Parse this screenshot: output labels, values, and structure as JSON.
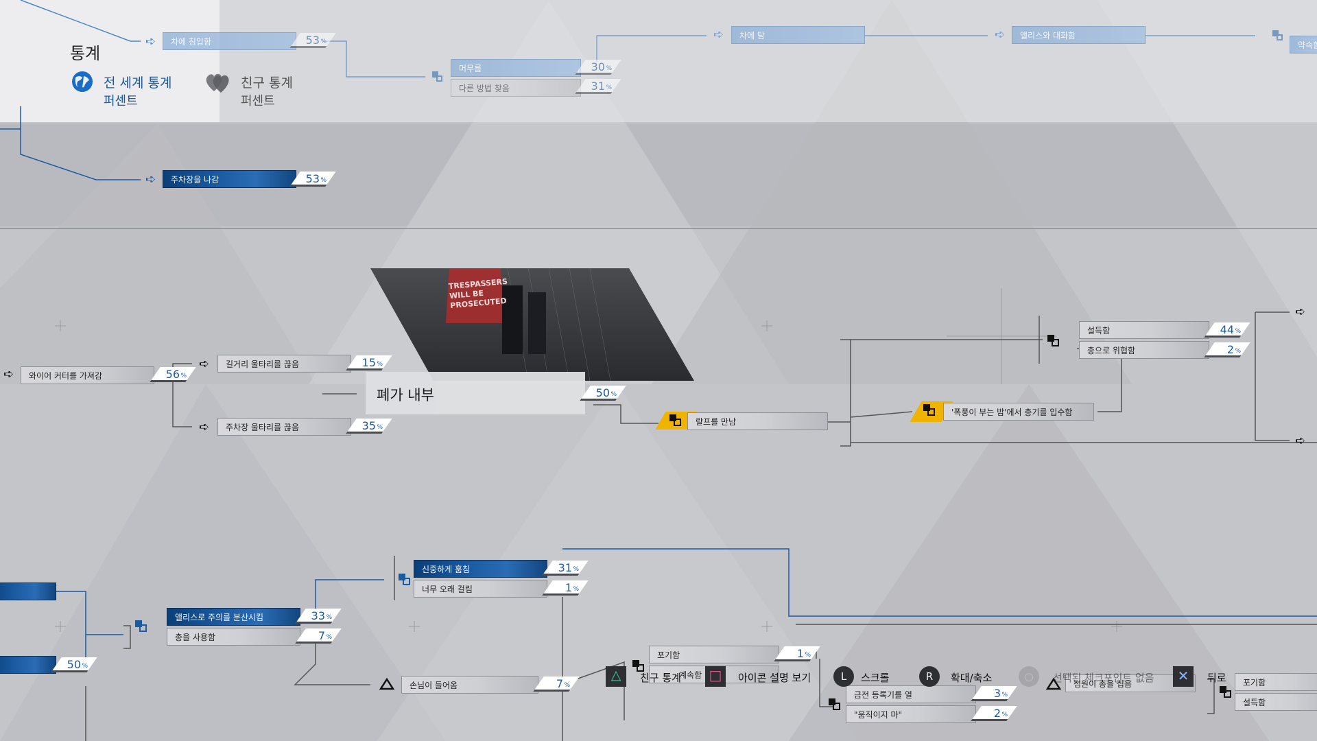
{
  "header": {
    "title": "통계",
    "global_tab": {
      "label": "전 세계 통계",
      "sub": "퍼센트"
    },
    "friends_tab": {
      "label": "친구 통계",
      "sub": "퍼센트"
    }
  },
  "nodes": {
    "top_row": [
      {
        "label": "차에 침입함",
        "percent": "53"
      },
      {
        "label": "머무름",
        "percent": "30"
      },
      {
        "label": "다른 방법 찾음",
        "percent": "31"
      },
      {
        "label": "차에 탐",
        "percent": ""
      },
      {
        "label": "앨리스와 대화함",
        "percent": ""
      },
      {
        "label": "약속함",
        "percent": ""
      }
    ],
    "leave_parking": {
      "label": "주차장을 나감",
      "percent": "53"
    },
    "wire_cutter": {
      "label": "와이어 커터를 가져감",
      "percent": "56"
    },
    "cut_street_fence": {
      "label": "길거리 울타리를 끊음",
      "percent": "15"
    },
    "cut_parking_fence": {
      "label": "주차장 울타리를 끊음",
      "percent": "35"
    },
    "chapter": {
      "title": "폐가 내부",
      "percent": "50",
      "sign_text": "TRESPASSERS WILL BE PROSECUTED"
    },
    "meet_ralph": {
      "label": "랄프를 만남"
    },
    "get_gun": {
      "label": "'폭풍이 부는 밤'에서 총기를 입수함"
    },
    "persuade": {
      "label": "설득함",
      "percent": "44"
    },
    "threaten_gun": {
      "label": "총으로 위협함",
      "percent": "2"
    },
    "steal_carefully": {
      "label": "신중하게 훔침",
      "percent": "31"
    },
    "took_too_long": {
      "label": "너무 오래 걸림",
      "percent": "1"
    },
    "distract_alice": {
      "label": "앨리스로 주의를 분산시킴",
      "percent": "33"
    },
    "use_gun": {
      "label": "총을 사용함",
      "percent": "7"
    },
    "left_bottom_pct": {
      "percent": "50"
    },
    "customer_enters": {
      "label": "손님이 들어옴",
      "percent": "7"
    },
    "give_up": {
      "label": "포기함",
      "percent": "1"
    },
    "continue_stealing": {
      "label": "계속함",
      "percent": ""
    },
    "open_register": {
      "label": "금전 등록기를 열",
      "percent": "3"
    },
    "dont_move": {
      "label": "\"움직이지 마\"",
      "percent": "2"
    },
    "clerk_takes_gun": {
      "label": "점원이 총을 집음"
    },
    "right_give_up": {
      "label": "포기함"
    },
    "right_persuade": {
      "label": "설득함"
    }
  },
  "controls": [
    {
      "key": "△",
      "label": "친구 통계"
    },
    {
      "key": "□",
      "label": "아이콘 설명 보기"
    },
    {
      "key": "L",
      "label": "스크롤"
    },
    {
      "key": "R",
      "label": "확대/축소"
    },
    {
      "key": "○",
      "label": "선택된 체크포인트 없음"
    },
    {
      "key": "✕",
      "label": "뒤로"
    }
  ],
  "colors": {
    "accent": "#1a5aa0",
    "lock_yellow": "#f0b400",
    "background": "#c4c5c9"
  },
  "icons": [
    "globe-icon",
    "hearts-icon",
    "arrow-right-icon",
    "branch-icon",
    "lock-icon",
    "warning-triangle-icon"
  ]
}
